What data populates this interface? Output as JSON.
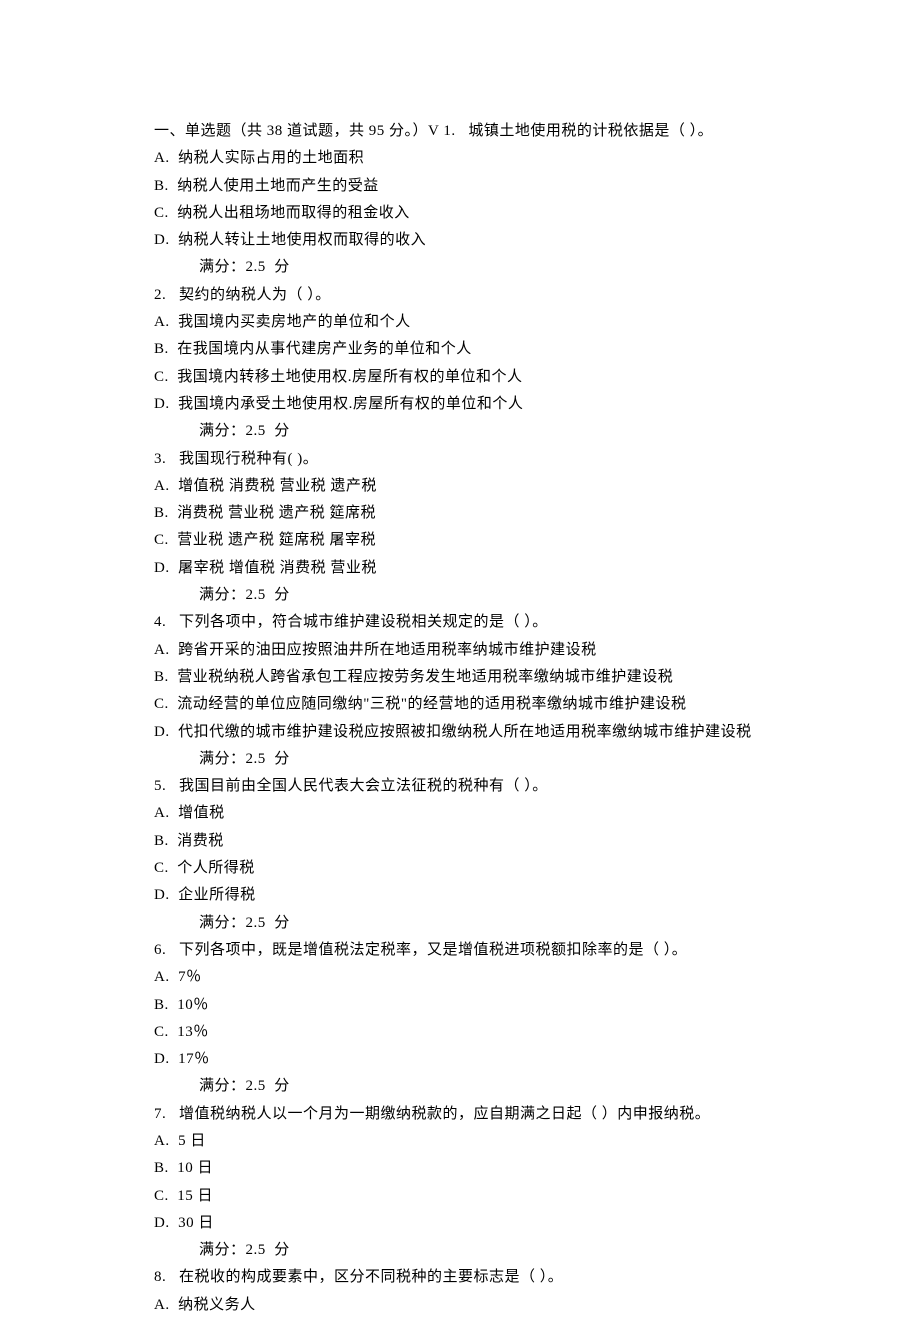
{
  "sectionHeader": "一、单选题（共 38 道试题，共 95 分。）V 1.   城镇土地使用税的计税依据是（ ）。",
  "scoreLabel": "满分：2.5  分",
  "questions": [
    {
      "options": [
        "A.  纳税人实际占用的土地面积",
        "B.  纳税人使用土地而产生的受益",
        "C.  纳税人出租场地而取得的租金收入",
        "D.  纳税人转让土地使用权而取得的收入"
      ]
    },
    {
      "stem": "2.   契约的纳税人为（ ）。",
      "options": [
        "A.  我国境内买卖房地产的单位和个人",
        "B.  在我国境内从事代建房产业务的单位和个人",
        "C.  我国境内转移土地使用权.房屋所有权的单位和个人",
        "D.  我国境内承受土地使用权.房屋所有权的单位和个人"
      ]
    },
    {
      "stem": "3.   我国现行税种有( )。",
      "options": [
        "A.  增值税 消费税 营业税 遗产税",
        "B.  消费税 营业税 遗产税 筵席税",
        "C.  营业税 遗产税 筵席税 屠宰税",
        "D.  屠宰税 增值税 消费税 营业税"
      ]
    },
    {
      "stem": "4.   下列各项中，符合城市维护建设税相关规定的是（ ）。",
      "options": [
        "A.  跨省开采的油田应按照油井所在地适用税率纳城市维护建设税",
        "B.  营业税纳税人跨省承包工程应按劳务发生地适用税率缴纳城市维护建设税",
        "C.  流动经营的单位应随同缴纳\"三税\"的经营地的适用税率缴纳城市维护建设税",
        "D.  代扣代缴的城市维护建设税应按照被扣缴纳税人所在地适用税率缴纳城市维护建设税"
      ]
    },
    {
      "stem": "5.   我国目前由全国人民代表大会立法征税的税种有（ ）。",
      "options": [
        "A.  增值税",
        "B.  消费税",
        "C.  个人所得税",
        "D.  企业所得税"
      ]
    },
    {
      "stem": "6.   下列各项中，既是增值税法定税率，又是增值税进项税额扣除率的是（ ）。",
      "options": [
        "A.  7％",
        "B.  10％",
        "C.  13％",
        "D.  17％"
      ]
    },
    {
      "stem": "7.   增值税纳税人以一个月为一期缴纳税款的，应自期满之日起（ ）内申报纳税。",
      "options": [
        "A.  5 日",
        "B.  10 日",
        "C.  15 日",
        "D.  30 日"
      ]
    },
    {
      "stem": "8.   在税收的构成要素中，区分不同税种的主要标志是（ ）。",
      "options": [
        "A.  纳税义务人"
      ],
      "noScore": true
    }
  ]
}
